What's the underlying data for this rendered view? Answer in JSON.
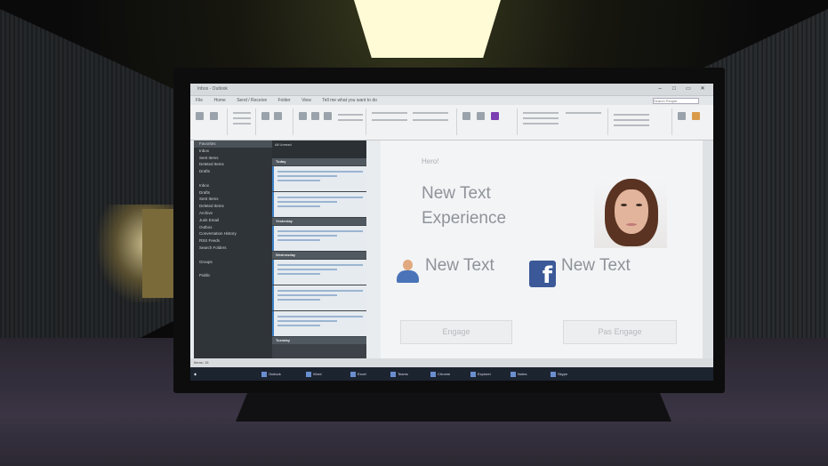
{
  "window": {
    "title": "Inbox - Outlook"
  },
  "ribbon_tabs": [
    "File",
    "Home",
    "Send / Receive",
    "Folder",
    "View",
    "Tell me what you want to do"
  ],
  "search": {
    "placeholder": "Search People"
  },
  "folders": [
    "Favorites",
    "Inbox",
    "Sent Items",
    "Deleted Items",
    "Drafts",
    "",
    "Inbox",
    "Drafts",
    "Sent Items",
    "Deleted Items",
    "Archive",
    "Junk Email",
    "Outbox",
    "Conversation History",
    "RSS Feeds",
    "Search Folders",
    "",
    "Groups",
    "",
    "Public"
  ],
  "message_list": {
    "header": "All Unread",
    "groups": [
      "Today",
      "Yesterday",
      "Wednesday",
      "Tuesday"
    ]
  },
  "reading_pane": {
    "hero_label": "Hero!",
    "title_line1": "New Text",
    "title_line2": "Experience",
    "item1_text": "New Text",
    "item2_text": "New Text",
    "facebook_glyph": "f",
    "engage_button": "Engage",
    "pas_engage_button": "Pas Engage"
  },
  "statusbar": {
    "text": "Items: 15"
  },
  "taskbar": [
    "Outlook",
    "Word",
    "Excel",
    "Teams",
    "Chrome",
    "Explorer",
    "Notes",
    "Skype"
  ]
}
